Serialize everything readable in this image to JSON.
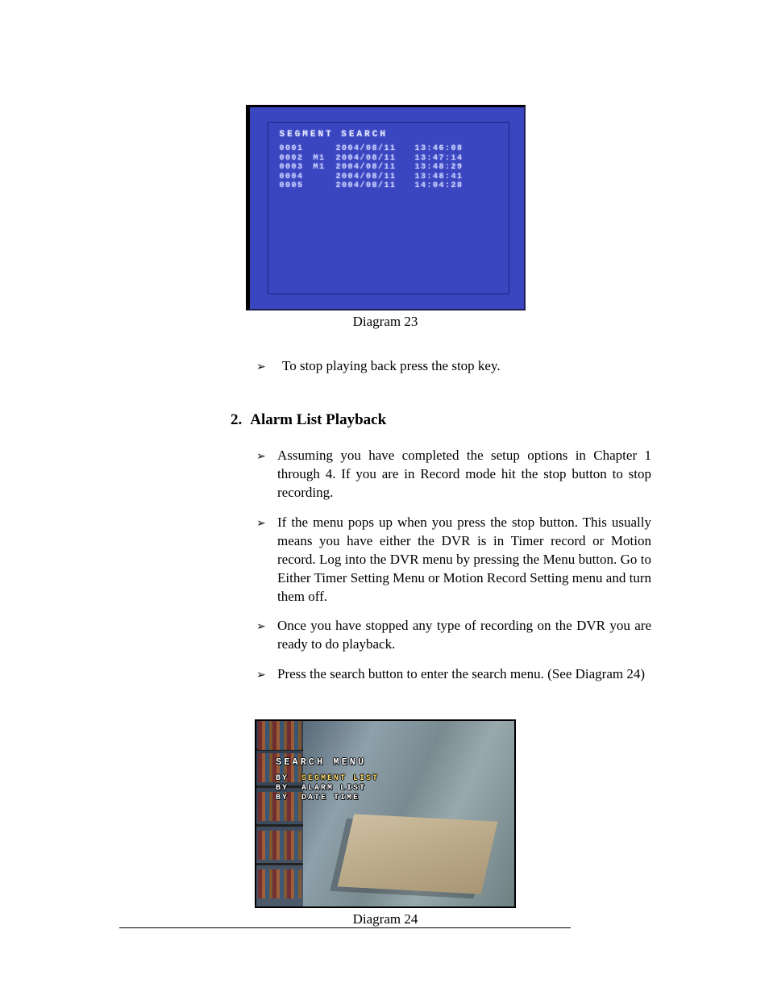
{
  "diagram23": {
    "title": "SEGMENT SEARCH",
    "rows": [
      {
        "idx": "0001",
        "mark": "",
        "date": "2004/08/11",
        "time": "13:46:08"
      },
      {
        "idx": "0002",
        "mark": "M1",
        "date": "2004/08/11",
        "time": "13:47:14"
      },
      {
        "idx": "0003",
        "mark": "M1",
        "date": "2004/08/11",
        "time": "13:48:29"
      },
      {
        "idx": "0004",
        "mark": "",
        "date": "2004/08/11",
        "time": "13:48:41"
      },
      {
        "idx": "0005",
        "mark": "",
        "date": "2004/08/11",
        "time": "14:04:28"
      }
    ],
    "caption": "Diagram 23"
  },
  "bullet_after_23": "To stop playing back press the stop key.",
  "section": {
    "num": "2.",
    "title": "Alarm List Playback"
  },
  "bullets": [
    "Assuming you have completed the setup options in Chapter 1 through 4. If you are in Record mode hit the stop button to stop recording.",
    "If the menu pops up when you press the stop button. This usually means you have either the DVR is in Timer record or Motion record. Log into the DVR menu by pressing the Menu button. Go to Either Timer Setting Menu or Motion Record Setting menu and turn them off.",
    "Once you have stopped any type of recording on the DVR you are ready to do playback.",
    "Press the search button to enter the search menu. (See Diagram 24)"
  ],
  "diagram24": {
    "osd_title": "SEARCH MENU",
    "rows": [
      {
        "by": "BY",
        "item": "SEGMENT LIST",
        "highlight": true
      },
      {
        "by": "BY",
        "item": "ALARM LIST",
        "highlight": false
      },
      {
        "by": "BY",
        "item": "DATE TIME",
        "highlight": false
      }
    ],
    "caption": "Diagram 24"
  },
  "glyphs": {
    "arrow": "➢"
  }
}
